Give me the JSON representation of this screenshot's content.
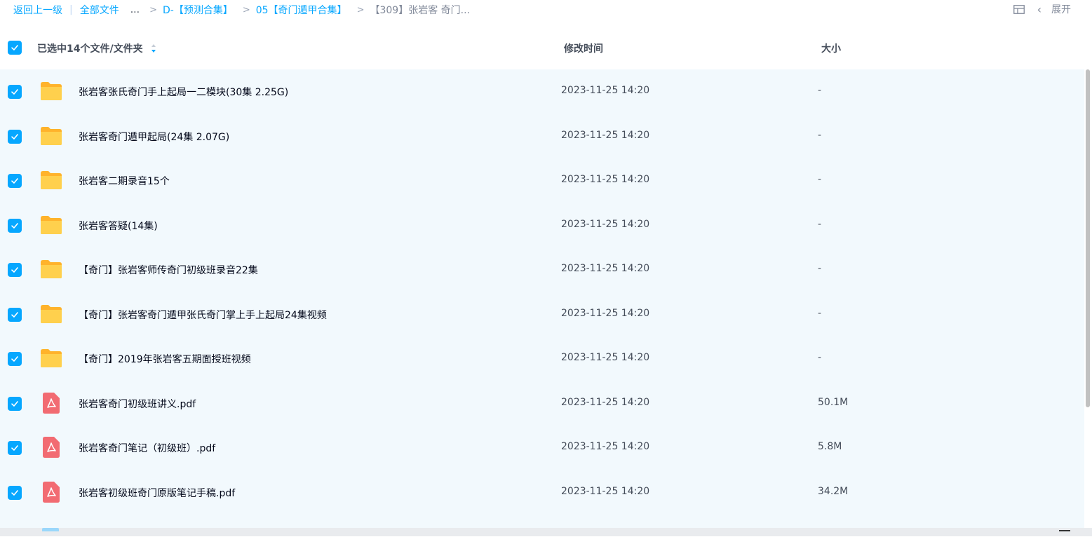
{
  "breadcrumb": {
    "back": "返回上一级",
    "divider": "|",
    "root": "全部文件",
    "sep": ">",
    "ellipsis": "...",
    "level1": "D-【预测合集】",
    "level2": "05【奇门遁甲合集】",
    "current": "【309】张岩客 奇门..."
  },
  "toolbar": {
    "grid_icon": "grid-view-icon",
    "chevron": "‹",
    "expand_label": "展开"
  },
  "header": {
    "selection_label": "已选中14个文件/文件夹",
    "time_label": "修改时间",
    "size_label": "大小"
  },
  "colors": {
    "accent": "#06a7ff",
    "row_bg": "#f2f9fd",
    "folder": "#ffc637",
    "pdf": "#f26b72"
  },
  "files": [
    {
      "name": "张岩客张氏奇门手上起局一二模块(30集 2.25G)",
      "time": "2023-11-25 14:20",
      "size": "-",
      "type": "folder"
    },
    {
      "name": "张岩客奇门遁甲起局(24集 2.07G)",
      "time": "2023-11-25 14:20",
      "size": "-",
      "type": "folder"
    },
    {
      "name": "张岩客二期录音15个",
      "time": "2023-11-25 14:20",
      "size": "-",
      "type": "folder"
    },
    {
      "name": "张岩客答疑(14集)",
      "time": "2023-11-25 14:20",
      "size": "-",
      "type": "folder"
    },
    {
      "name": "【奇门】张岩客师传奇门初级班录音22集",
      "time": "2023-11-25 14:20",
      "size": "-",
      "type": "folder"
    },
    {
      "name": "【奇门】张岩客奇门遁甲张氏奇门掌上手上起局24集视频",
      "time": "2023-11-25 14:20",
      "size": "-",
      "type": "folder"
    },
    {
      "name": "【奇门】2019年张岩客五期面授班视频",
      "time": "2023-11-25 14:20",
      "size": "-",
      "type": "folder"
    },
    {
      "name": "张岩客奇门初级班讲义.pdf",
      "time": "2023-11-25 14:20",
      "size": "50.1M",
      "type": "pdf"
    },
    {
      "name": "张岩客奇门笔记（初级班）.pdf",
      "time": "2023-11-25 14:20",
      "size": "5.8M",
      "type": "pdf"
    },
    {
      "name": "张岩客初级班奇门原版笔记手稿.pdf",
      "time": "2023-11-25 14:20",
      "size": "34.2M",
      "type": "pdf"
    }
  ]
}
